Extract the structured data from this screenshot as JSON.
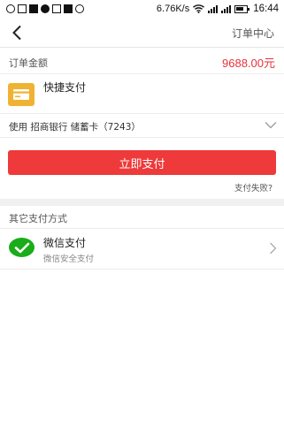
{
  "status_bar": {
    "speed": "6.76K/s",
    "time": "16:44",
    "icons": [
      "alarm-icon",
      "app-icon",
      "sim-icon",
      "photo-icon",
      "image-icon",
      "notes-icon",
      "circle-icon",
      "wifi-icon",
      "signal-icon",
      "signal-icon",
      "battery-icon"
    ]
  },
  "nav": {
    "back_icon": "chevron-left-icon",
    "order_center": "订单中心"
  },
  "order": {
    "amount_label": "订单金额",
    "amount_value": "9688.00元"
  },
  "quick_pay": {
    "title": "快捷支付",
    "icon": "card-icon",
    "icon_color": "#f0b232"
  },
  "bank": {
    "text": "使用 招商银行 储蓄卡（7243）",
    "chevron": "chevron-down-icon"
  },
  "pay_button": {
    "label": "立即支付",
    "color": "#ee3a3a"
  },
  "fail_link": "支付失败?",
  "other_methods": {
    "title": "其它支付方式",
    "items": [
      {
        "title": "微信支付",
        "subtitle": "微信安全支付",
        "icon": "wechat-icon",
        "icon_color": "#1aad19",
        "arrow": "chevron-right-icon"
      }
    ]
  },
  "colors": {
    "accent": "#e8323d",
    "background": "#ffffff",
    "divider": "#f0f0f0"
  }
}
